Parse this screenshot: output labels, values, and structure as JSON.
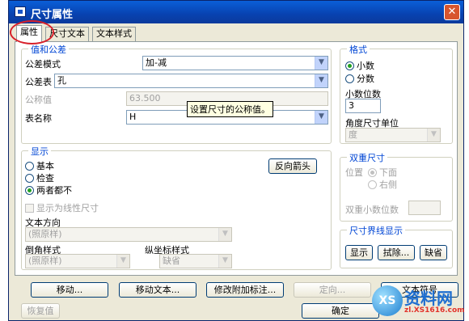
{
  "window": {
    "title": "尺寸属性",
    "close_glyph": "✕"
  },
  "tabs": [
    {
      "label": "属性",
      "active": true
    },
    {
      "label": "尺寸文本",
      "active": false
    },
    {
      "label": "文本样式",
      "active": false
    }
  ],
  "values_group": {
    "title": "值和公差",
    "tolerance_mode": {
      "label": "公差模式",
      "value": "加-减"
    },
    "tolerance_table": {
      "label": "公差表",
      "value": "孔"
    },
    "nominal": {
      "label": "公称值",
      "value": "63.500"
    },
    "table_name": {
      "label": "表名称",
      "value": "H"
    }
  },
  "tooltip": "设置尺寸的公称值。",
  "format_group": {
    "title": "格式",
    "decimal": {
      "label": "小数",
      "selected": true
    },
    "fraction": {
      "label": "分数",
      "selected": false
    },
    "decimal_places": {
      "label": "小数位数",
      "value": "3"
    },
    "angle_unit": {
      "label": "角度尺寸单位",
      "value": "度"
    }
  },
  "display_group": {
    "title": "显示",
    "basic": {
      "label": "基本",
      "selected": false
    },
    "inspect": {
      "label": "检查",
      "selected": false
    },
    "neither": {
      "label": "两者都不",
      "selected": true
    },
    "flip_arrows": "反向箭头",
    "linear_checkbox": "显示为线性尺寸",
    "text_direction": {
      "label": "文本方向",
      "value": "(照原样)"
    },
    "chamfer_style": {
      "label": "倒角样式",
      "value": "(照原样)"
    },
    "ordinate_style": {
      "label": "纵坐标样式",
      "value": "缺省"
    }
  },
  "dual_group": {
    "title": "双重尺寸",
    "position_label": "位置",
    "below": {
      "label": "下面",
      "selected": true
    },
    "right": {
      "label": "右侧",
      "selected": false
    },
    "dual_decimal_label": "双重小数位数"
  },
  "witness_group": {
    "title": "尺寸界线显示",
    "show": "显示",
    "erase": "拭除...",
    "default": "缺省"
  },
  "bottom_buttons": {
    "move": "移动...",
    "move_text": "移动文本...",
    "modify_attach": "修改附加标注...",
    "orient": "定向...",
    "text_symbol": "文本符号",
    "restore": "恢复值",
    "ok": "确定"
  },
  "watermark": {
    "logo": "XS",
    "title": "资料网",
    "url": "zl.XS1616.com"
  },
  "icons": {
    "dropdown": "▼",
    "app": "window-app-icon"
  }
}
